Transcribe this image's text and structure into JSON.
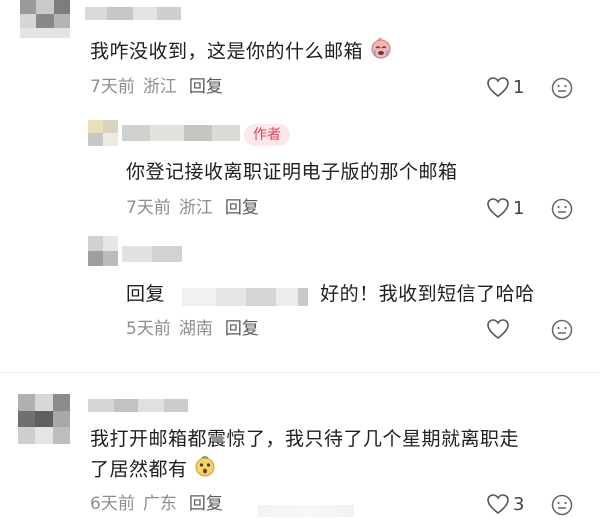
{
  "comments": [
    {
      "text": "我咋没收到，这是你的什么邮箱",
      "emoji": "crying-face-emoji",
      "time": "7天前",
      "location": "浙江",
      "reply_label": "回复",
      "likes": "1"
    },
    {
      "author_tag": "作者",
      "text": "你登记接收离职证明电子版的那个邮箱",
      "time": "7天前",
      "location": "浙江",
      "reply_label": "回复",
      "likes": "1"
    },
    {
      "reply_prefix": "回复",
      "text": "好的！我收到短信了哈哈",
      "time": "5天前",
      "location": "湖南",
      "reply_label": "回复",
      "likes": ""
    },
    {
      "text_line1": "我打开邮箱都震惊了，我只待了几个星期就离职走",
      "text_line2": "了居然都有",
      "emoji": "surprised-face-emoji",
      "time": "6天前",
      "location": "广东",
      "reply_label": "回复",
      "likes": "3"
    }
  ],
  "colors": {
    "author_tag_bg": "#fde7ea",
    "author_tag_text": "#e0455a",
    "meta": "#8e8e8e",
    "body_text": "#1f1f1f"
  }
}
